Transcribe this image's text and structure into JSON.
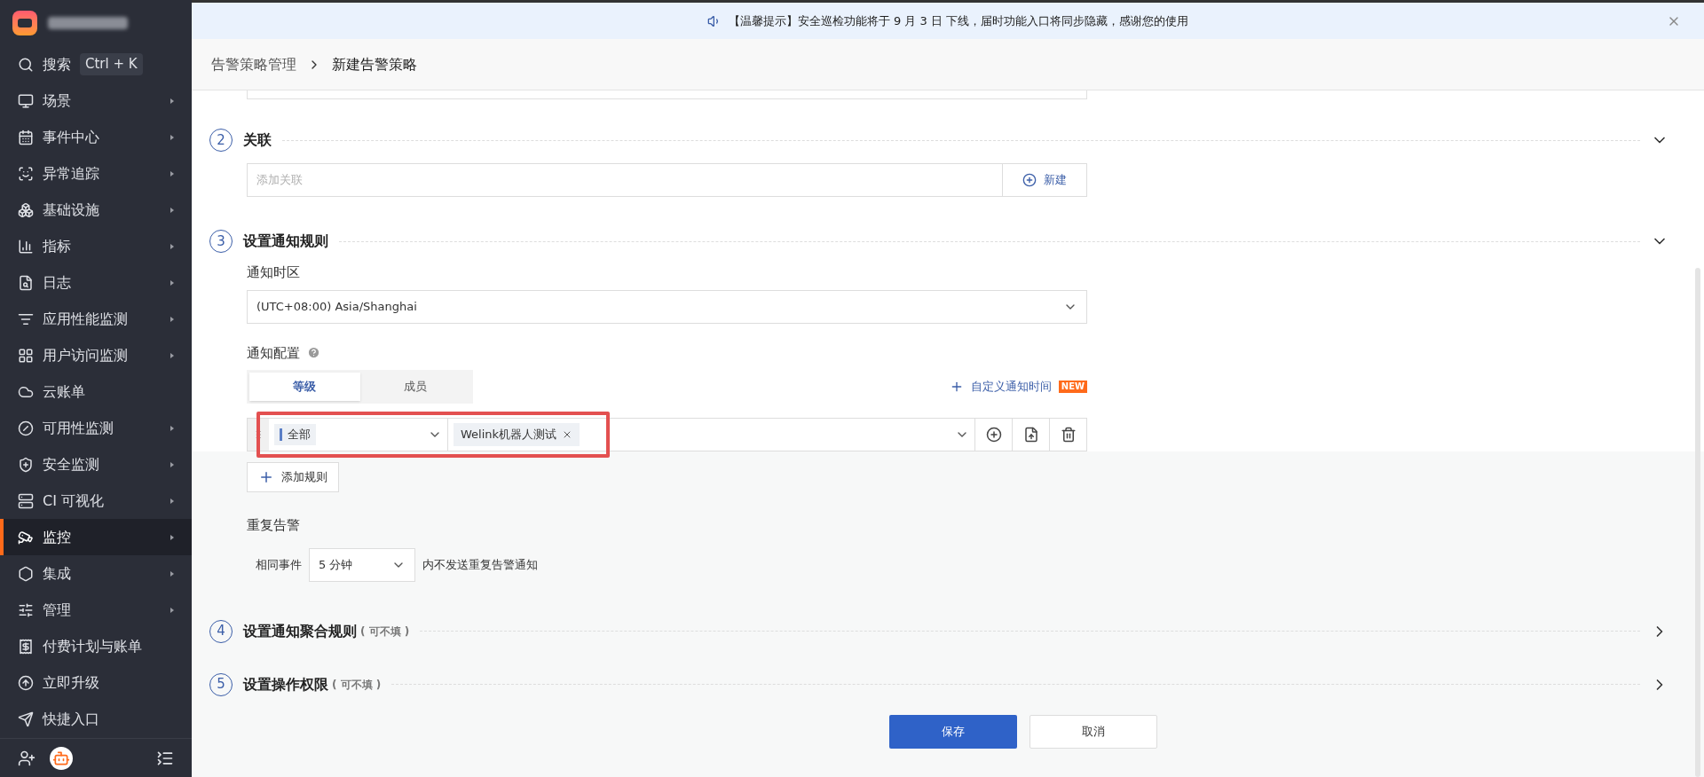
{
  "sidebar": {
    "search": {
      "label": "搜索",
      "shortcut": "Ctrl + K"
    },
    "items": [
      {
        "label": "场景",
        "has_submenu": true,
        "selected": false
      },
      {
        "label": "事件中心",
        "has_submenu": true,
        "selected": false
      },
      {
        "label": "异常追踪",
        "has_submenu": true,
        "selected": false
      },
      {
        "label": "基础设施",
        "has_submenu": true,
        "selected": false
      },
      {
        "label": "指标",
        "has_submenu": true,
        "selected": false
      },
      {
        "label": "日志",
        "has_submenu": true,
        "selected": false
      },
      {
        "label": "应用性能监测",
        "has_submenu": true,
        "selected": false
      },
      {
        "label": "用户访问监测",
        "has_submenu": true,
        "selected": false
      },
      {
        "label": "云账单",
        "has_submenu": false,
        "selected": false
      },
      {
        "label": "可用性监测",
        "has_submenu": true,
        "selected": false
      },
      {
        "label": "安全监测",
        "has_submenu": true,
        "selected": false
      },
      {
        "label": "CI 可视化",
        "has_submenu": true,
        "selected": false
      },
      {
        "label": "监控",
        "has_submenu": true,
        "selected": true
      },
      {
        "label": "集成",
        "has_submenu": true,
        "selected": false
      },
      {
        "label": "管理",
        "has_submenu": true,
        "selected": false
      },
      {
        "label": "付费计划与账单",
        "has_submenu": false,
        "selected": false
      },
      {
        "label": "立即升级",
        "has_submenu": false,
        "selected": false
      },
      {
        "label": "快捷入口",
        "has_submenu": false,
        "selected": false
      }
    ]
  },
  "banner": {
    "text": "【温馨提示】安全巡检功能将于 9 月 3 日 下线，届时功能入口将同步隐藏，感谢您的使用"
  },
  "breadcrumb": [
    "告警策略管理",
    "新建告警策略"
  ],
  "sections": [
    {
      "number": "2",
      "title": "关联",
      "expanded": true
    },
    {
      "number": "3",
      "title": "设置通知规则",
      "expanded": true
    },
    {
      "number": "4",
      "title": "设置通知聚合规则",
      "note": "( 可不填 )",
      "expanded": false
    },
    {
      "number": "5",
      "title": "设置操作权限",
      "note": "( 可不填 )",
      "expanded": false
    }
  ],
  "association": {
    "placeholder": "添加关联",
    "new_button": "新建"
  },
  "timezone": {
    "label": "通知时区",
    "value": "(UTC+08:00) Asia/Shanghai"
  },
  "notify_config": {
    "label": "通知配置",
    "tabs": [
      {
        "label": "等级",
        "selected": true
      },
      {
        "label": "成员",
        "selected": false
      }
    ],
    "custom_time": "自定义通知时间",
    "new_badge": "NEW",
    "rule": {
      "level_tag": "全部",
      "target_tag": "Welink机器人测试"
    },
    "add_rule": "添加规则"
  },
  "repeat": {
    "label": "重复告警",
    "prefix": "相同事件",
    "value": "5 分钟",
    "suffix": "内不发送重复告警通知"
  },
  "buttons": {
    "save": "保存",
    "cancel": "取消"
  }
}
